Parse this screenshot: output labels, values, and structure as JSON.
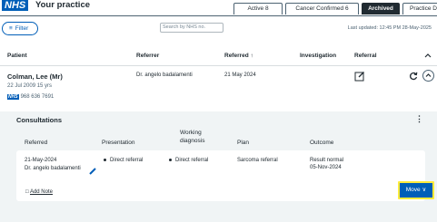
{
  "header": {
    "logo": "NHS",
    "title": "Your practice",
    "tabs": [
      {
        "label": "Active  8"
      },
      {
        "label": "Cancer Confirmed  6"
      },
      {
        "label": "Archived"
      },
      {
        "label": "Practice Data"
      }
    ]
  },
  "toolbar": {
    "filter_label": "Filter",
    "search_placeholder": "Search by NHS no.",
    "last_updated": "Last updated: 12:45 PM 28-May-2025"
  },
  "table": {
    "columns": [
      "Patient",
      "Referrer",
      "Referred ↑",
      "Investigation",
      "Referral"
    ]
  },
  "patient": {
    "name": "Colman, Lee (Mr)",
    "dob": "22 Jul 2009   15 yrs",
    "nhs_badge": "NHS",
    "nhs_number": "968 636 7691",
    "referrer": "Dr. angelo badalamenti",
    "referred": "21 May 2024"
  },
  "consultations": {
    "title": "Consultations",
    "menu_icon": "⋮",
    "columns": {
      "referred": "Referred",
      "presentation": "Presentation",
      "working_diagnosis": "Working diagnosis",
      "plan": "Plan",
      "outcome": "Outcome"
    },
    "row": {
      "referred_date": "21-May-2024",
      "referrer": "Dr. angelo badalamenti",
      "presentation": "Direct referral",
      "working_diagnosis": "Direct referral",
      "plan": "Sarcoma referral",
      "outcome_line1": "Result normal",
      "outcome_line2": "05-Nov-2024"
    },
    "add_note": "Add Note",
    "move_label": "Move ∨"
  },
  "colors": {
    "nhs_blue": "#005eb8",
    "highlight": "#ffeb3b",
    "text": "#212b32"
  }
}
